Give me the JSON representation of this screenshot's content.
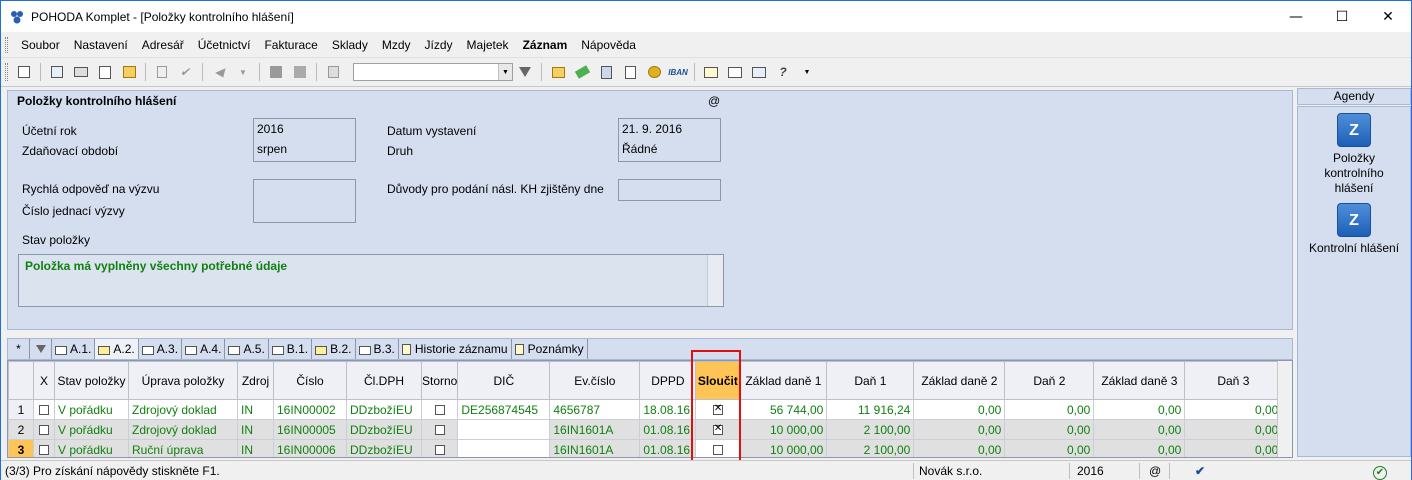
{
  "window": {
    "title": "POHODA Komplet - [Položky kontrolního hlášení]",
    "minimize": "—",
    "maximize": "☐",
    "close": "✕"
  },
  "menu": [
    "Soubor",
    "Nastavení",
    "Adresář",
    "Účetnictví",
    "Fakturace",
    "Sklady",
    "Mzdy",
    "Jízdy",
    "Majetek",
    "Záznam",
    "Nápověda"
  ],
  "form": {
    "header": "Položky kontrolního hlášení",
    "at": "@",
    "ucetni_rok_label": "Účetní rok",
    "ucetni_rok": "2016",
    "zdanovaci_label": "Zdaňovací období",
    "zdanovaci": "srpen",
    "datum_label": "Datum vystavení",
    "datum": "21. 9. 2016",
    "druh_label": "Druh",
    "druh": "Řádné",
    "rychla_label": "Rychlá odpověď na výzvu",
    "cislo_jed_label": "Číslo jednací výzvy",
    "duvody_label": "Důvody pro podání násl. KH zjištěny dne",
    "stav_label": "Stav položky",
    "stav_text": "Položka má vyplněny všechny potřebné údaje"
  },
  "agendy": {
    "header": "Agendy",
    "items": [
      {
        "label": "Položky kontrolního hlášení"
      },
      {
        "label": "Kontrolní hlášení"
      }
    ]
  },
  "tabs": [
    "A.1.",
    "A.2.",
    "A.3.",
    "A.4.",
    "A.5.",
    "B.1.",
    "B.2.",
    "B.3.",
    "Historie záznamu",
    "Poznámky"
  ],
  "tabs_star": "*",
  "grid": {
    "columns": [
      "",
      "X",
      "Stav položky",
      "Úprava položky",
      "Zdroj",
      "Číslo",
      "Čl.DPH",
      "Storno",
      "DIČ",
      "Ev.číslo",
      "DPPD",
      "Sloučit",
      "Základ daně 1",
      "Daň 1",
      "Základ daně 2",
      "Daň 2",
      "Základ daně 3",
      "Daň 3"
    ],
    "rows": [
      {
        "n": "1",
        "stav": "V pořádku",
        "uprava": "Zdrojový doklad",
        "zdroj": "IN",
        "cislo": "16IN00002",
        "cldph": "DDzbožíEU",
        "dic": "DE256874545",
        "ev": "4656787",
        "dppd": "18.08.16",
        "slouc": true,
        "z1": "56 744,00",
        "d1": "11 916,24",
        "z2": "0,00",
        "d2": "0,00",
        "z3": "0,00",
        "d3": "0,00"
      },
      {
        "n": "2",
        "stav": "V pořádku",
        "uprava": "Zdrojový doklad",
        "zdroj": "IN",
        "cislo": "16IN00005",
        "cldph": "DDzbožíEU",
        "dic": "",
        "ev": "16IN1601A",
        "dppd": "01.08.16",
        "slouc": true,
        "z1": "10 000,00",
        "d1": "2 100,00",
        "z2": "0,00",
        "d2": "0,00",
        "z3": "0,00",
        "d3": "0,00"
      },
      {
        "n": "3",
        "stav": "V pořádku",
        "uprava": "Ruční úprava",
        "zdroj": "IN",
        "cislo": "16IN00006",
        "cldph": "DDzbožíEU",
        "dic": "",
        "ev": "16IN1601A",
        "dppd": "01.08.16",
        "slouc": false,
        "z1": "10 000,00",
        "d1": "2 100,00",
        "z2": "0,00",
        "d2": "0,00",
        "z3": "0,00",
        "d3": "0,00"
      }
    ]
  },
  "status": {
    "hint": "(3/3) Pro získání nápovědy stiskněte F1.",
    "company": "Novák s.r.o.",
    "year": "2016",
    "at": "@"
  }
}
